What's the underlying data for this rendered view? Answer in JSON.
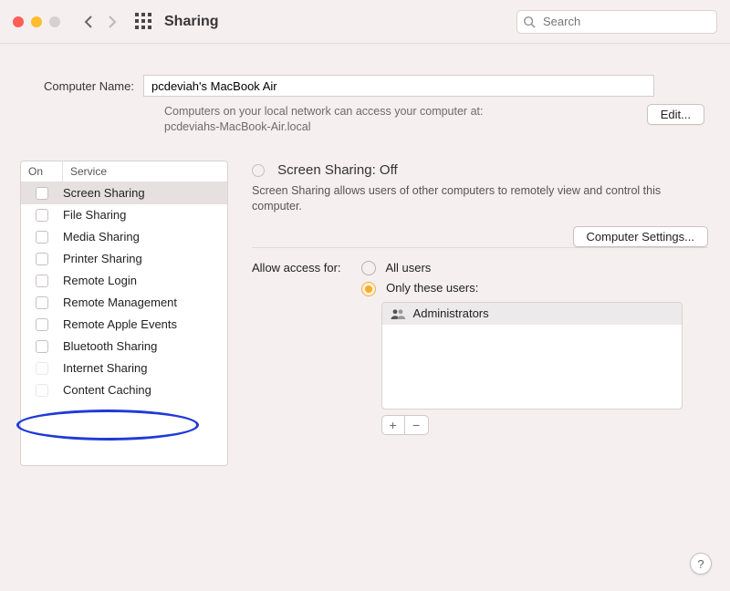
{
  "window": {
    "title": "Sharing",
    "search_placeholder": "Search"
  },
  "computer": {
    "label": "Computer Name:",
    "value": "pcdeviah's MacBook Air",
    "note_line1": "Computers on your local network can access your computer at:",
    "note_line2": "pcdeviahs-MacBook-Air.local",
    "edit": "Edit..."
  },
  "services": {
    "col_on": "On",
    "col_service": "Service",
    "items": [
      {
        "label": "Screen Sharing",
        "selected": true,
        "dim": false
      },
      {
        "label": "File Sharing",
        "dim": false
      },
      {
        "label": "Media Sharing",
        "dim": false
      },
      {
        "label": "Printer Sharing",
        "dim": false
      },
      {
        "label": "Remote Login",
        "dim": false
      },
      {
        "label": "Remote Management",
        "dim": false
      },
      {
        "label": "Remote Apple Events",
        "dim": false
      },
      {
        "label": "Bluetooth Sharing",
        "dim": false
      },
      {
        "label": "Internet Sharing",
        "dim": true
      },
      {
        "label": "Content Caching",
        "dim": true
      }
    ]
  },
  "detail": {
    "title": "Screen Sharing: Off",
    "desc": "Screen Sharing allows users of other computers to remotely view and control this computer.",
    "settings_btn": "Computer Settings...",
    "access_label": "Allow access for:",
    "opt_all": "All users",
    "opt_only": "Only these users:",
    "user0": "Administrators",
    "plus": "+",
    "minus": "−"
  },
  "help": "?"
}
